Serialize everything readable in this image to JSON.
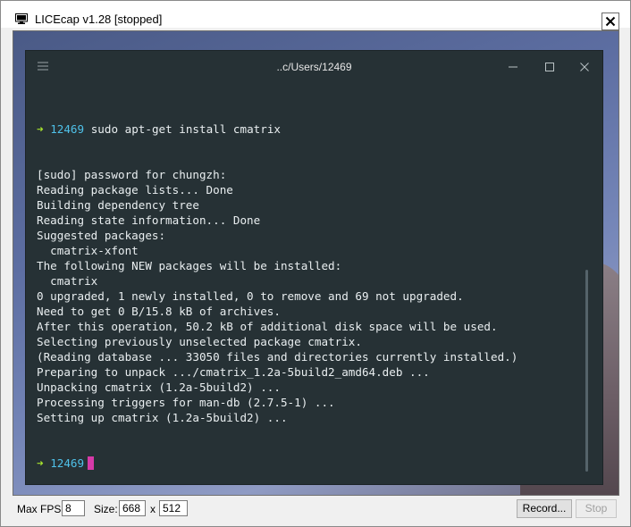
{
  "window": {
    "title": "LICEcap v1.28 [stopped]",
    "close_glyph": "✕"
  },
  "terminal": {
    "title": "..c/Users/12469",
    "prompt_arrow": "➜",
    "prompt_dir": "12469",
    "command": "sudo apt-get install cmatrix",
    "output": [
      "[sudo] password for chungzh:",
      "Reading package lists... Done",
      "Building dependency tree",
      "Reading state information... Done",
      "Suggested packages:",
      "  cmatrix-xfont",
      "The following NEW packages will be installed:",
      "  cmatrix",
      "0 upgraded, 1 newly installed, 0 to remove and 69 not upgraded.",
      "Need to get 0 B/15.8 kB of archives.",
      "After this operation, 50.2 kB of additional disk space will be used.",
      "Selecting previously unselected package cmatrix.",
      "(Reading database ... 33050 files and directories currently installed.)",
      "Preparing to unpack .../cmatrix_1.2a-5build2_amd64.deb ...",
      "Unpacking cmatrix (1.2a-5build2) ...",
      "Processing triggers for man-db (2.7.5-1) ...",
      "Setting up cmatrix (1.2a-5build2) ..."
    ],
    "colors": {
      "background": "#263135",
      "prompt_arrow": "#a6e22e",
      "prompt_dir": "#4fc1e9",
      "cursor": "#d63aa8"
    }
  },
  "controls": {
    "fps_label": "Max FPS:",
    "fps_value": "8",
    "size_label": "Size:",
    "width_value": "668",
    "size_separator": "x",
    "height_value": "512",
    "record_label": "Record...",
    "stop_label": "Stop"
  }
}
